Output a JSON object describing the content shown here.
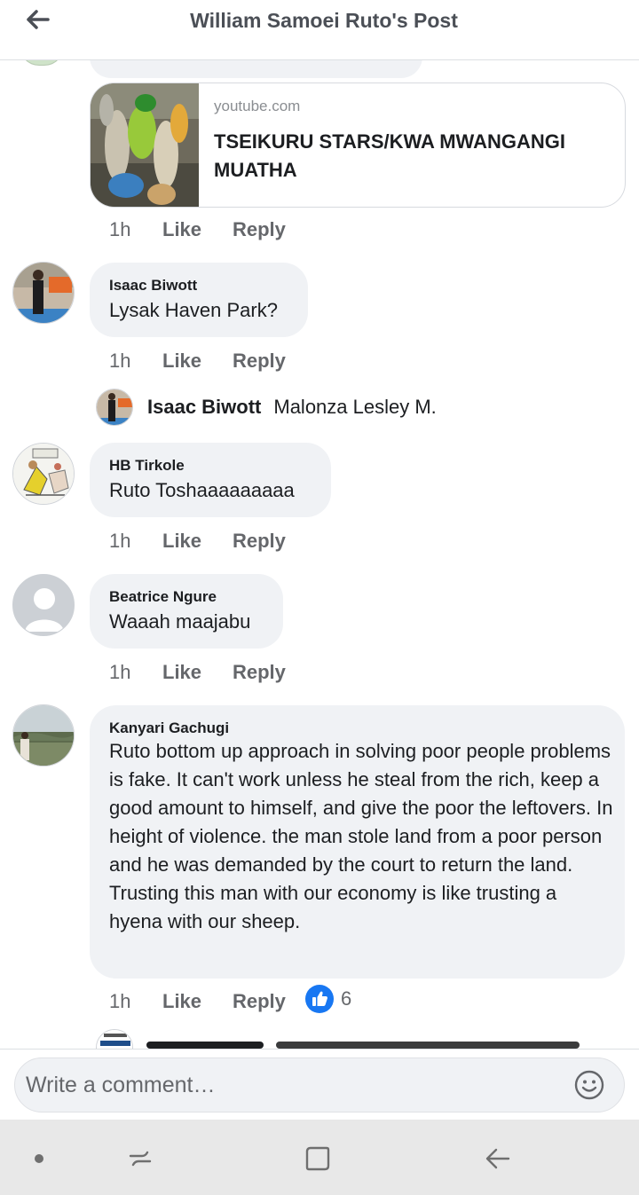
{
  "header": {
    "title": "William Samoei Ruto's Post"
  },
  "link_preview": {
    "domain": "youtube.com",
    "title": "TSEIKURU STARS/KWA MWANGANGI MUATHA"
  },
  "comments": [
    {
      "author": "",
      "text": "",
      "time": "1h",
      "like": "Like",
      "reply": "Reply"
    },
    {
      "author": "Isaac Biwott",
      "text": "Lysak Haven Park?",
      "time": "1h",
      "like": "Like",
      "reply": "Reply"
    },
    {
      "author": "HB Tirkole",
      "text": "Ruto Toshaaaaaaaaa",
      "time": "1h",
      "like": "Like",
      "reply": "Reply"
    },
    {
      "author": "Beatrice Ngure",
      "text": "Waaah maajabu",
      "time": "1h",
      "like": "Like",
      "reply": "Reply"
    },
    {
      "author": "Kanyari Gachugi",
      "text": "Ruto bottom up approach in solving poor people problems is fake. It can't work unless he steal from the rich, keep a good amount to himself, and give the poor the leftovers. In height of violence. the man stole land from a poor person and he was demanded by the court to return the land. Trusting this man with our economy is like trusting a hyena with our sheep.",
      "time": "1h",
      "like": "Like",
      "reply": "Reply",
      "reaction_count": "6"
    }
  ],
  "nested_reply": {
    "author": "Isaac Biwott",
    "text": "Malonza Lesley M."
  },
  "composer": {
    "placeholder": "Write a comment…"
  },
  "icons": {
    "back": "arrow-left-icon",
    "emoji": "smiley-icon",
    "like_reaction": "thumbs-up-icon",
    "nav_dot": "dot-icon",
    "nav_recents": "recents-icon",
    "nav_home": "home-square-icon",
    "nav_back": "back-icon"
  },
  "colors": {
    "reaction_blue": "#1877f2",
    "bubble": "#f0f2f5",
    "secondary_text": "#65676b"
  }
}
